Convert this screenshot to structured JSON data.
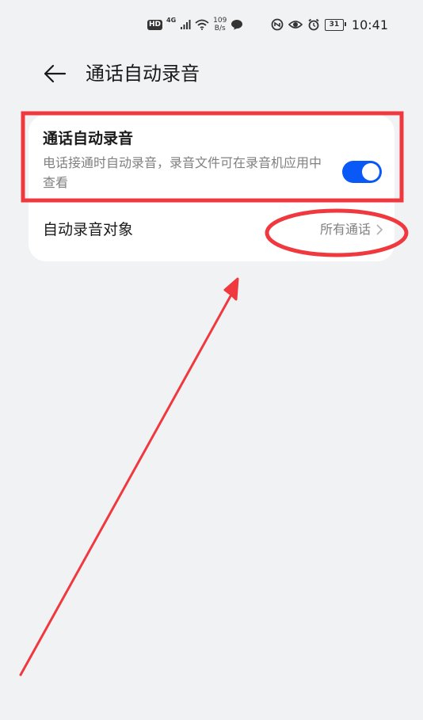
{
  "status_bar": {
    "hd_badge": "HD",
    "network": "4G",
    "speed_value": "109",
    "speed_unit": "B/s",
    "battery": "31",
    "time": "10:41",
    "icons": [
      "hd-icon",
      "signal-icon",
      "wifi-icon",
      "chat-bubble-icon",
      "nfc-icon",
      "eye-icon",
      "alarm-icon",
      "battery-icon"
    ]
  },
  "header": {
    "title": "通话自动录音",
    "back_icon": "back-arrow-icon"
  },
  "settings": {
    "auto_record": {
      "title": "通话自动录音",
      "description": "电话接通时自动录音，录音文件可在录音机应用中查看",
      "enabled": true
    },
    "record_target": {
      "label": "自动录音对象",
      "value": "所有通话",
      "chevron_icon": "chevron-right-icon"
    }
  },
  "colors": {
    "accent": "#0a59f7",
    "annotation": "#f0393f",
    "background": "#f1f2f4",
    "card": "#ffffff"
  }
}
